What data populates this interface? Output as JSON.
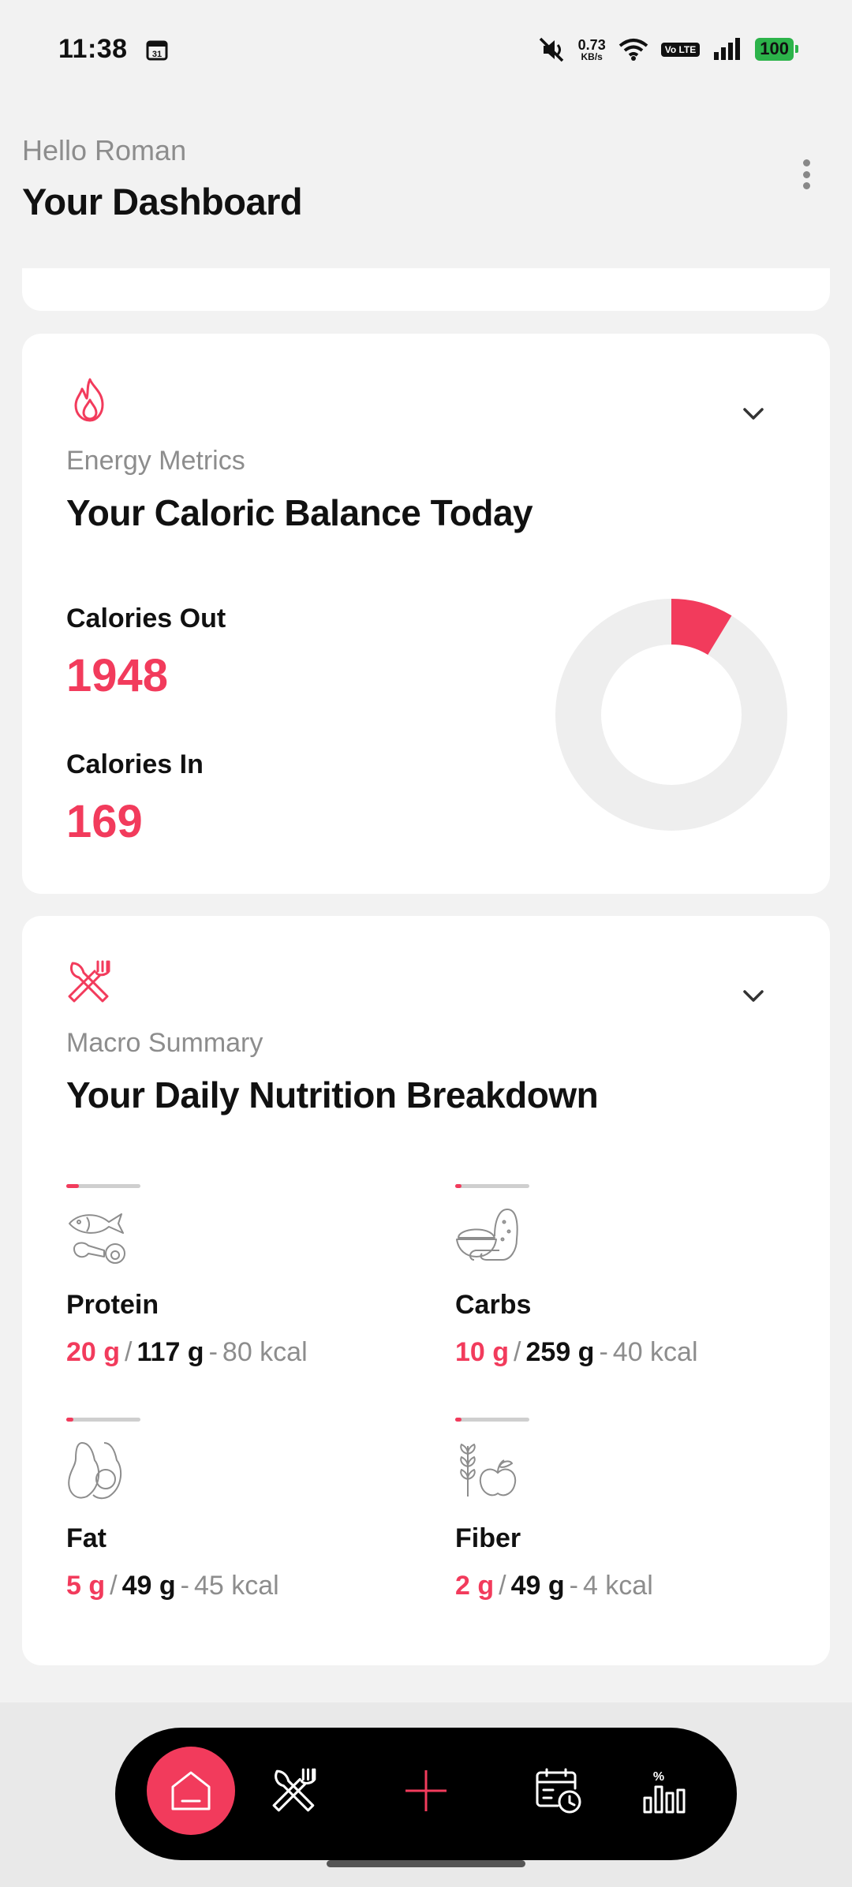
{
  "status_bar": {
    "time": "11:38",
    "net_speed_value": "0.73",
    "net_speed_unit": "KB/s",
    "volte": "Vo LTE",
    "battery": "100"
  },
  "header": {
    "greeting": "Hello Roman",
    "title": "Your Dashboard"
  },
  "energy": {
    "subtitle": "Energy Metrics",
    "title": "Your Caloric Balance Today",
    "calories_out_label": "Calories Out",
    "calories_out_value": "1948",
    "calories_in_label": "Calories In",
    "calories_in_value": "169",
    "donut_fraction": 0.087
  },
  "macro": {
    "subtitle": "Macro Summary",
    "title": "Your Daily  Nutrition Breakdown",
    "items": [
      {
        "name": "Protein",
        "intake": "20 g",
        "goal": "117 g",
        "kcal": "80 kcal",
        "progress": 0.17
      },
      {
        "name": "Carbs",
        "intake": "10 g",
        "goal": "259 g",
        "kcal": "40 kcal",
        "progress": 0.04
      },
      {
        "name": "Fat",
        "intake": "5 g",
        "goal": "49 g",
        "kcal": "45 kcal",
        "progress": 0.1
      },
      {
        "name": "Fiber",
        "intake": "2 g",
        "goal": "49 g",
        "kcal": "4 kcal",
        "progress": 0.04
      }
    ]
  },
  "nav": {
    "items": [
      "home-icon",
      "fork-knife-icon",
      "plus-icon",
      "calendar-clock-icon",
      "stats-icon"
    ]
  },
  "colors": {
    "accent": "#f23b5c",
    "track": "#eeeeee"
  }
}
